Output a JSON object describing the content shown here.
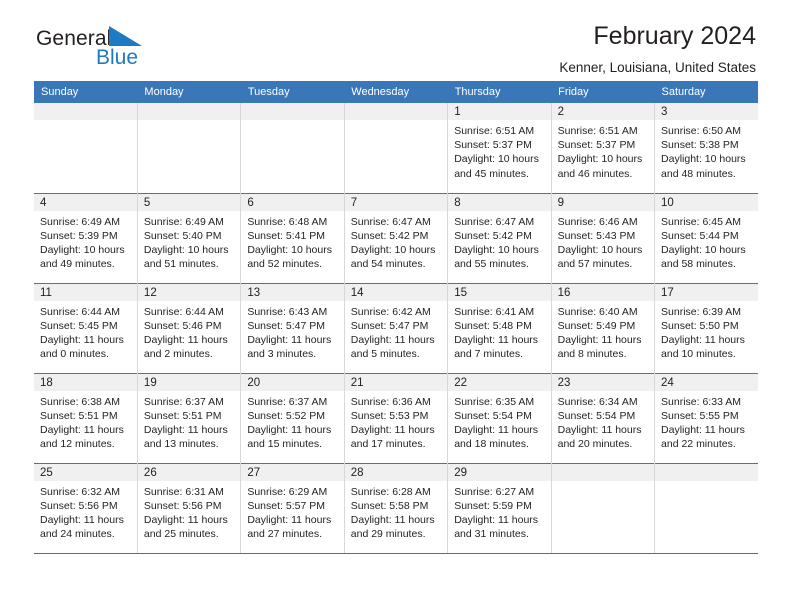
{
  "brand": {
    "name_top": "General",
    "name_bottom": "Blue",
    "triangle_icon": "triangle-icon",
    "accent_color": "#1f7ac4"
  },
  "header": {
    "title": "February 2024",
    "location": "Kenner, Louisiana, United States"
  },
  "calendar": {
    "header_bg": "#3a77b8",
    "daynum_bg": "#f0f0f0",
    "weekdays": [
      "Sunday",
      "Monday",
      "Tuesday",
      "Wednesday",
      "Thursday",
      "Friday",
      "Saturday"
    ],
    "labels": {
      "sunrise": "Sunrise:",
      "sunset": "Sunset:",
      "daylight": "Daylight:"
    },
    "weeks": [
      [
        {
          "day": ""
        },
        {
          "day": ""
        },
        {
          "day": ""
        },
        {
          "day": ""
        },
        {
          "day": "1",
          "sunrise": "Sunrise: 6:51 AM",
          "sunset": "Sunset: 5:37 PM",
          "daylight_1": "Daylight: 10 hours",
          "daylight_2": "and 45 minutes."
        },
        {
          "day": "2",
          "sunrise": "Sunrise: 6:51 AM",
          "sunset": "Sunset: 5:37 PM",
          "daylight_1": "Daylight: 10 hours",
          "daylight_2": "and 46 minutes."
        },
        {
          "day": "3",
          "sunrise": "Sunrise: 6:50 AM",
          "sunset": "Sunset: 5:38 PM",
          "daylight_1": "Daylight: 10 hours",
          "daylight_2": "and 48 minutes."
        }
      ],
      [
        {
          "day": "4",
          "sunrise": "Sunrise: 6:49 AM",
          "sunset": "Sunset: 5:39 PM",
          "daylight_1": "Daylight: 10 hours",
          "daylight_2": "and 49 minutes."
        },
        {
          "day": "5",
          "sunrise": "Sunrise: 6:49 AM",
          "sunset": "Sunset: 5:40 PM",
          "daylight_1": "Daylight: 10 hours",
          "daylight_2": "and 51 minutes."
        },
        {
          "day": "6",
          "sunrise": "Sunrise: 6:48 AM",
          "sunset": "Sunset: 5:41 PM",
          "daylight_1": "Daylight: 10 hours",
          "daylight_2": "and 52 minutes."
        },
        {
          "day": "7",
          "sunrise": "Sunrise: 6:47 AM",
          "sunset": "Sunset: 5:42 PM",
          "daylight_1": "Daylight: 10 hours",
          "daylight_2": "and 54 minutes."
        },
        {
          "day": "8",
          "sunrise": "Sunrise: 6:47 AM",
          "sunset": "Sunset: 5:42 PM",
          "daylight_1": "Daylight: 10 hours",
          "daylight_2": "and 55 minutes."
        },
        {
          "day": "9",
          "sunrise": "Sunrise: 6:46 AM",
          "sunset": "Sunset: 5:43 PM",
          "daylight_1": "Daylight: 10 hours",
          "daylight_2": "and 57 minutes."
        },
        {
          "day": "10",
          "sunrise": "Sunrise: 6:45 AM",
          "sunset": "Sunset: 5:44 PM",
          "daylight_1": "Daylight: 10 hours",
          "daylight_2": "and 58 minutes."
        }
      ],
      [
        {
          "day": "11",
          "sunrise": "Sunrise: 6:44 AM",
          "sunset": "Sunset: 5:45 PM",
          "daylight_1": "Daylight: 11 hours",
          "daylight_2": "and 0 minutes."
        },
        {
          "day": "12",
          "sunrise": "Sunrise: 6:44 AM",
          "sunset": "Sunset: 5:46 PM",
          "daylight_1": "Daylight: 11 hours",
          "daylight_2": "and 2 minutes."
        },
        {
          "day": "13",
          "sunrise": "Sunrise: 6:43 AM",
          "sunset": "Sunset: 5:47 PM",
          "daylight_1": "Daylight: 11 hours",
          "daylight_2": "and 3 minutes."
        },
        {
          "day": "14",
          "sunrise": "Sunrise: 6:42 AM",
          "sunset": "Sunset: 5:47 PM",
          "daylight_1": "Daylight: 11 hours",
          "daylight_2": "and 5 minutes."
        },
        {
          "day": "15",
          "sunrise": "Sunrise: 6:41 AM",
          "sunset": "Sunset: 5:48 PM",
          "daylight_1": "Daylight: 11 hours",
          "daylight_2": "and 7 minutes."
        },
        {
          "day": "16",
          "sunrise": "Sunrise: 6:40 AM",
          "sunset": "Sunset: 5:49 PM",
          "daylight_1": "Daylight: 11 hours",
          "daylight_2": "and 8 minutes."
        },
        {
          "day": "17",
          "sunrise": "Sunrise: 6:39 AM",
          "sunset": "Sunset: 5:50 PM",
          "daylight_1": "Daylight: 11 hours",
          "daylight_2": "and 10 minutes."
        }
      ],
      [
        {
          "day": "18",
          "sunrise": "Sunrise: 6:38 AM",
          "sunset": "Sunset: 5:51 PM",
          "daylight_1": "Daylight: 11 hours",
          "daylight_2": "and 12 minutes."
        },
        {
          "day": "19",
          "sunrise": "Sunrise: 6:37 AM",
          "sunset": "Sunset: 5:51 PM",
          "daylight_1": "Daylight: 11 hours",
          "daylight_2": "and 13 minutes."
        },
        {
          "day": "20",
          "sunrise": "Sunrise: 6:37 AM",
          "sunset": "Sunset: 5:52 PM",
          "daylight_1": "Daylight: 11 hours",
          "daylight_2": "and 15 minutes."
        },
        {
          "day": "21",
          "sunrise": "Sunrise: 6:36 AM",
          "sunset": "Sunset: 5:53 PM",
          "daylight_1": "Daylight: 11 hours",
          "daylight_2": "and 17 minutes."
        },
        {
          "day": "22",
          "sunrise": "Sunrise: 6:35 AM",
          "sunset": "Sunset: 5:54 PM",
          "daylight_1": "Daylight: 11 hours",
          "daylight_2": "and 18 minutes."
        },
        {
          "day": "23",
          "sunrise": "Sunrise: 6:34 AM",
          "sunset": "Sunset: 5:54 PM",
          "daylight_1": "Daylight: 11 hours",
          "daylight_2": "and 20 minutes."
        },
        {
          "day": "24",
          "sunrise": "Sunrise: 6:33 AM",
          "sunset": "Sunset: 5:55 PM",
          "daylight_1": "Daylight: 11 hours",
          "daylight_2": "and 22 minutes."
        }
      ],
      [
        {
          "day": "25",
          "sunrise": "Sunrise: 6:32 AM",
          "sunset": "Sunset: 5:56 PM",
          "daylight_1": "Daylight: 11 hours",
          "daylight_2": "and 24 minutes."
        },
        {
          "day": "26",
          "sunrise": "Sunrise: 6:31 AM",
          "sunset": "Sunset: 5:56 PM",
          "daylight_1": "Daylight: 11 hours",
          "daylight_2": "and 25 minutes."
        },
        {
          "day": "27",
          "sunrise": "Sunrise: 6:29 AM",
          "sunset": "Sunset: 5:57 PM",
          "daylight_1": "Daylight: 11 hours",
          "daylight_2": "and 27 minutes."
        },
        {
          "day": "28",
          "sunrise": "Sunrise: 6:28 AM",
          "sunset": "Sunset: 5:58 PM",
          "daylight_1": "Daylight: 11 hours",
          "daylight_2": "and 29 minutes."
        },
        {
          "day": "29",
          "sunrise": "Sunrise: 6:27 AM",
          "sunset": "Sunset: 5:59 PM",
          "daylight_1": "Daylight: 11 hours",
          "daylight_2": "and 31 minutes."
        },
        {
          "day": ""
        },
        {
          "day": ""
        }
      ]
    ]
  }
}
